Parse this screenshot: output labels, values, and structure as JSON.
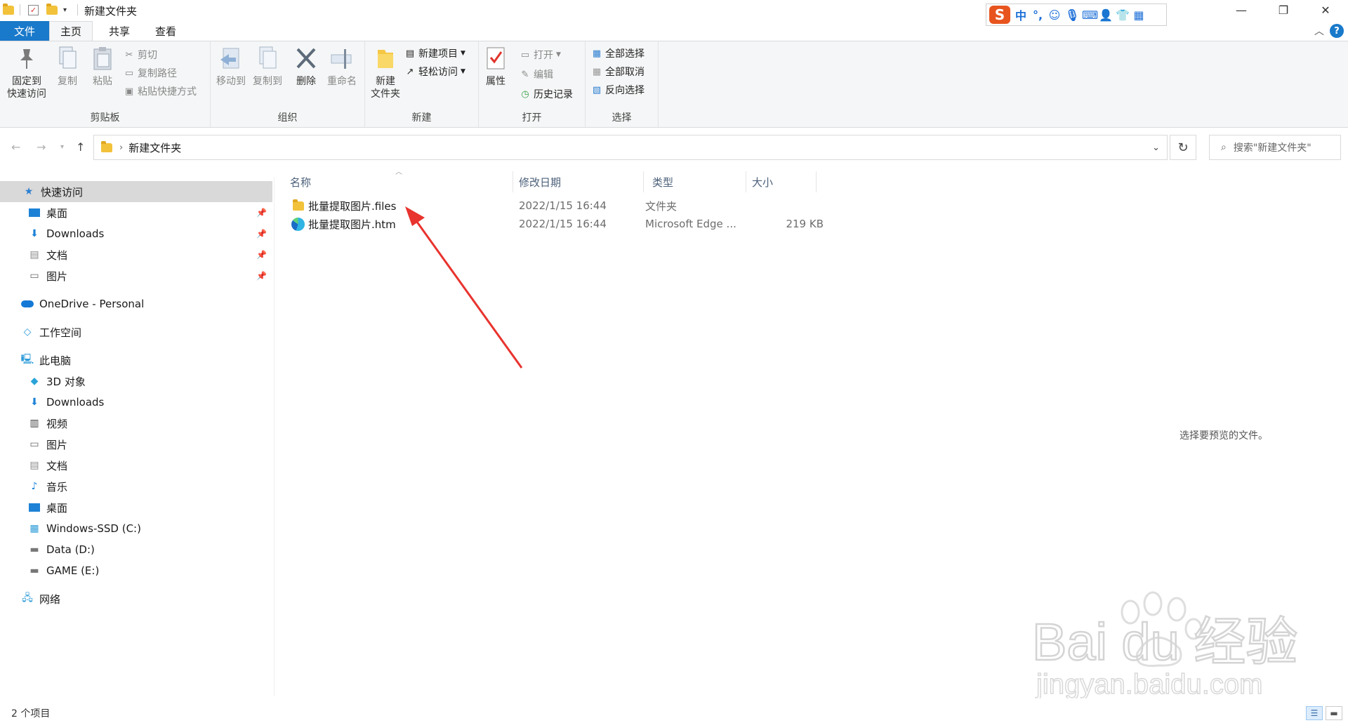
{
  "window": {
    "title": "新建文件夹",
    "controls": {
      "minimize": "—",
      "restore": "❐",
      "close": "✕"
    }
  },
  "ime": {
    "logo": "S",
    "mode": "中"
  },
  "ribbon_tabs": [
    "文件",
    "主页",
    "共享",
    "查看"
  ],
  "ribbon": {
    "clipboard": {
      "label": "剪贴板",
      "pin": "固定到\n快速访问",
      "copy": "复制",
      "paste": "粘贴",
      "cut": "剪切",
      "copy_path": "复制路径",
      "paste_shortcut": "粘贴快捷方式"
    },
    "organize": {
      "label": "组织",
      "move_to": "移动到",
      "copy_to": "复制到",
      "delete": "删除",
      "rename": "重命名"
    },
    "new": {
      "label": "新建",
      "new_folder": "新建\n文件夹",
      "new_item": "新建项目",
      "easy_access": "轻松访问"
    },
    "open": {
      "label": "打开",
      "properties": "属性",
      "open": "打开",
      "edit": "编辑",
      "history": "历史记录"
    },
    "select": {
      "label": "选择",
      "select_all": "全部选择",
      "select_none": "全部取消",
      "invert": "反向选择"
    }
  },
  "address": {
    "path": "新建文件夹",
    "search_placeholder": "搜索\"新建文件夹\""
  },
  "nav": {
    "quick_access": "快速访问",
    "quick_items": [
      "桌面",
      "Downloads",
      "文档",
      "图片"
    ],
    "onedrive": "OneDrive - Personal",
    "workspace": "工作空间",
    "this_pc": "此电脑",
    "pc_items": [
      "3D 对象",
      "Downloads",
      "视频",
      "图片",
      "文档",
      "音乐",
      "桌面",
      "Windows-SSD (C:)",
      "Data (D:)",
      "GAME (E:)"
    ],
    "network": "网络"
  },
  "columns": {
    "name": "名称",
    "modified": "修改日期",
    "type": "类型",
    "size": "大小"
  },
  "files": [
    {
      "name": "批量提取图片.files",
      "modified": "2022/1/15 16:44",
      "type": "文件夹",
      "size": ""
    },
    {
      "name": "批量提取图片.htm",
      "modified": "2022/1/15 16:44",
      "type": "Microsoft Edge ...",
      "size": "219 KB"
    }
  ],
  "preview_empty": "选择要预览的文件。",
  "status": {
    "count": "2 个项目"
  },
  "watermark": {
    "line1": "Bai du 经验",
    "line2": "jingyan.baidu.com"
  },
  "colors": {
    "accent": "#1979ca",
    "selected_nav": "#cce8ff",
    "annotation_arrow": "#e8332e"
  }
}
